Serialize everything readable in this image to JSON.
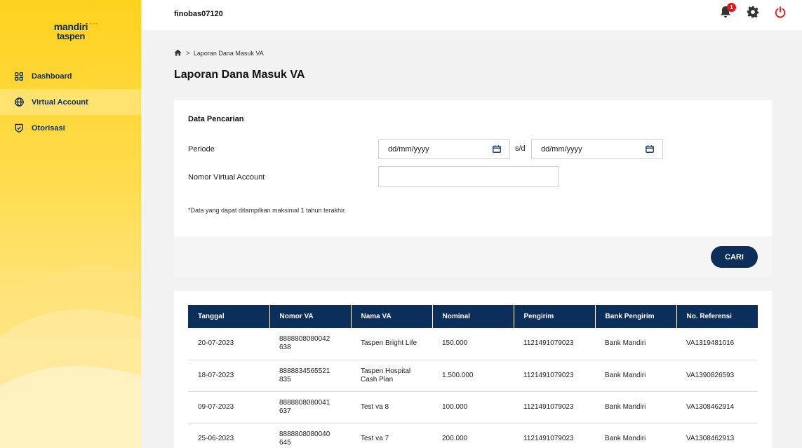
{
  "brand": {
    "line1": "mandiri",
    "line2": "taspen"
  },
  "sidebar": {
    "items": [
      {
        "label": "Dashboard",
        "icon": "grid-icon",
        "active": false
      },
      {
        "label": "Virtual Account",
        "icon": "globe-icon",
        "active": true
      },
      {
        "label": "Otorisasi",
        "icon": "shield-check-icon",
        "active": false
      }
    ]
  },
  "topbar": {
    "username": "finobas07120",
    "notification_count": "1",
    "icons": [
      "bell-icon",
      "gear-icon",
      "power-icon"
    ]
  },
  "breadcrumb": {
    "current": "Laporan Dana Masuk VA"
  },
  "page_title": "Laporan Dana Masuk VA",
  "search": {
    "title": "Data Pencarian",
    "periode_label": "Periode",
    "date_from_placeholder": "dd/mm/yyyy",
    "date_separator": "s/d",
    "date_to_placeholder": "dd/mm/yyyy",
    "va_label": "Nomor Virtual Account",
    "va_value": "",
    "note": "*Data yang dapat ditampilkan maksimal 1 tahun terakhir.",
    "button": "CARI"
  },
  "table": {
    "headers": [
      "Tanggal",
      "Nomor VA",
      "Nama VA",
      "Nominal",
      "Pengirim",
      "Bank Pengirim",
      "No. Referensi"
    ],
    "rows": [
      [
        "20-07-2023",
        "8888808080042\n638",
        "Taspen Bright Life",
        "150.000",
        "1121491079023",
        "Bank Mandiri",
        "VA1319481016"
      ],
      [
        "18-07-2023",
        "8888834565521\n835",
        "Taspen Hospital\nCash Plan",
        "1.500.000",
        "1121491079023",
        "Bank Mandiri",
        "VA1390826593"
      ],
      [
        "09-07-2023",
        "8888808080041\n637",
        "Test va 8",
        "100.000",
        "1121491079023",
        "Bank Mandiri",
        "VA1308462914"
      ],
      [
        "25-06-2023",
        "8888808080040\n645",
        "Test va 7",
        "200.000",
        "1121491079023",
        "Bank Mandiri",
        "VA1308462913"
      ]
    ]
  },
  "colors": {
    "primary": "#0c2e5b",
    "accent": "#ffd21f",
    "danger": "#e5151c"
  }
}
